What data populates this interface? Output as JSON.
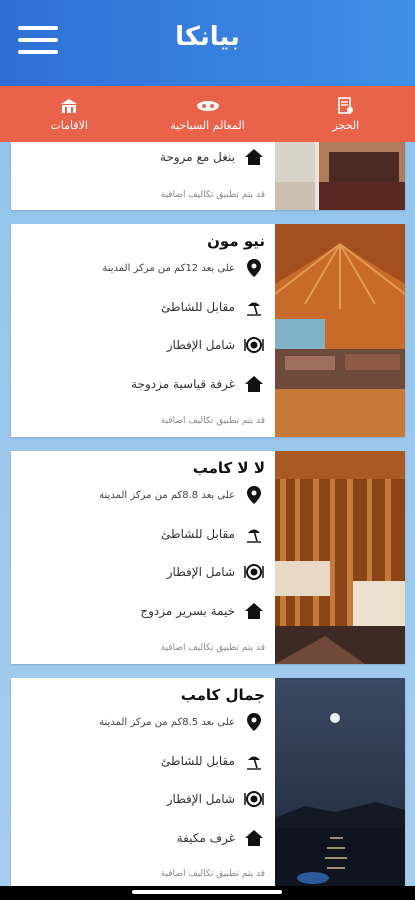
{
  "app": {
    "title": "بيانكا"
  },
  "tabs": [
    {
      "label": "الحجز",
      "icon": "booking-icon"
    },
    {
      "label": "المعالم السياحية",
      "icon": "landmarks-icon"
    },
    {
      "label": "الاقامات",
      "icon": "accommodations-icon"
    }
  ],
  "cards": [
    {
      "name": "",
      "rows": [
        {
          "icon": "home-icon",
          "text": "بنغل مع مروحة"
        }
      ],
      "note": "قد يتم تطبيق تكاليف اضافية"
    },
    {
      "name": "نيو مون",
      "rows": [
        {
          "icon": "location-icon",
          "text": "على بعد 12كم من مركز المدينة"
        },
        {
          "icon": "beach-icon",
          "text": "مقابل للشاطئ"
        },
        {
          "icon": "breakfast-icon",
          "text": "شامل الإفطار"
        },
        {
          "icon": "home-icon",
          "text": "غرفة قياسية مزدوجة"
        }
      ],
      "note": "قد يتم تطبيق تكاليف اضافية"
    },
    {
      "name": "لا لا كامب",
      "rows": [
        {
          "icon": "location-icon",
          "text": "على بعد 8.8كم من مركز المدينة"
        },
        {
          "icon": "beach-icon",
          "text": "مقابل للشاطئ"
        },
        {
          "icon": "breakfast-icon",
          "text": "شامل الإفطار"
        },
        {
          "icon": "home-icon",
          "text": "خيمة بسرير مزدوج"
        }
      ],
      "note": "قد يتم تطبيق تكاليف اضافية"
    },
    {
      "name": "جمال كامب",
      "rows": [
        {
          "icon": "location-icon",
          "text": "على بعد 8.5كم من مركز المدينة"
        },
        {
          "icon": "beach-icon",
          "text": "مقابل للشاطئ"
        },
        {
          "icon": "breakfast-icon",
          "text": "شامل الإفطار"
        },
        {
          "icon": "home-icon",
          "text": "غرف مكيفة"
        }
      ],
      "note": "قد يتم تطبيق تكاليف اضافية"
    }
  ],
  "colors": {
    "appbar": "#2f6fd6",
    "tabbar": "#e8634a",
    "background": "#a7cdee"
  }
}
